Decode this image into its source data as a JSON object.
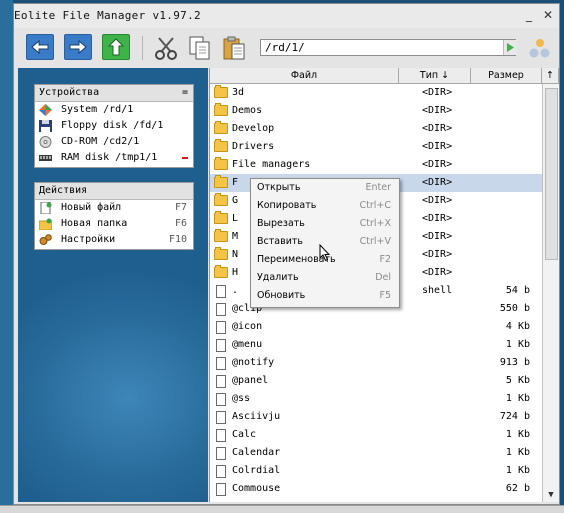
{
  "window": {
    "title": "Eolite File Manager v1.97.2",
    "minimize_glyph": "_",
    "close_glyph": "✕"
  },
  "toolbar": {
    "back_icon": "arrow-left-icon",
    "forward_icon": "arrow-right-icon",
    "up_icon": "arrow-up-icon",
    "path": "/rd/1/"
  },
  "drives_panel": {
    "title": "Устройства",
    "collapse_glyph": "=",
    "items": [
      {
        "label": "System /rd/1",
        "icon": "system-drive-icon"
      },
      {
        "label": "Floppy disk /fd/1",
        "icon": "floppy-icon"
      },
      {
        "label": "CD-ROM /cd2/1",
        "icon": "cdrom-icon"
      },
      {
        "label": "RAM disk /tmp1/1",
        "icon": "ram-disk-icon"
      }
    ]
  },
  "actions_panel": {
    "title": "Действия",
    "items": [
      {
        "label": "Новый файл",
        "key": "F7"
      },
      {
        "label": "Новая папка",
        "key": "F6"
      },
      {
        "label": "Настройки",
        "key": "F10"
      }
    ]
  },
  "filelist": {
    "columns": {
      "name": "Файл",
      "type": "Тип ↓",
      "size": "Размер",
      "sort_arrow": "↑"
    },
    "rows": [
      {
        "name": "3d",
        "type": "<DIR>",
        "size": "",
        "kind": "folder"
      },
      {
        "name": "Demos",
        "type": "<DIR>",
        "size": "",
        "kind": "folder"
      },
      {
        "name": "Develop",
        "type": "<DIR>",
        "size": "",
        "kind": "folder"
      },
      {
        "name": "Drivers",
        "type": "<DIR>",
        "size": "",
        "kind": "folder"
      },
      {
        "name": "File managers",
        "type": "<DIR>",
        "size": "",
        "kind": "folder"
      },
      {
        "name": "F",
        "type": "<DIR>",
        "size": "",
        "kind": "folder"
      },
      {
        "name": "G",
        "type": "<DIR>",
        "size": "",
        "kind": "folder"
      },
      {
        "name": "L",
        "type": "<DIR>",
        "size": "",
        "kind": "folder"
      },
      {
        "name": "M",
        "type": "<DIR>",
        "size": "",
        "kind": "folder"
      },
      {
        "name": "N",
        "type": "<DIR>",
        "size": "",
        "kind": "folder"
      },
      {
        "name": "H",
        "type": "<DIR>",
        "size": "",
        "kind": "folder"
      },
      {
        "name": ".",
        "type": "shell",
        "size": "54 b",
        "kind": "file"
      },
      {
        "name": "@clip",
        "type": "",
        "size": "550 b",
        "kind": "file"
      },
      {
        "name": "@icon",
        "type": "",
        "size": "4 Kb",
        "kind": "file"
      },
      {
        "name": "@menu",
        "type": "",
        "size": "1 Kb",
        "kind": "file"
      },
      {
        "name": "@notify",
        "type": "",
        "size": "913 b",
        "kind": "file"
      },
      {
        "name": "@panel",
        "type": "",
        "size": "5 Kb",
        "kind": "file"
      },
      {
        "name": "@ss",
        "type": "",
        "size": "1 Kb",
        "kind": "file"
      },
      {
        "name": "Asciivju",
        "type": "",
        "size": "724 b",
        "kind": "file"
      },
      {
        "name": "Calc",
        "type": "",
        "size": "1 Kb",
        "kind": "file"
      },
      {
        "name": "Calendar",
        "type": "",
        "size": "1 Kb",
        "kind": "file"
      },
      {
        "name": "Colrdial",
        "type": "",
        "size": "1 Kb",
        "kind": "file"
      },
      {
        "name": "Commouse",
        "type": "",
        "size": "62 b",
        "kind": "file"
      }
    ]
  },
  "context_menu": {
    "items": [
      {
        "label": "Открыть",
        "key": "Enter"
      },
      {
        "label": "Копировать",
        "key": "Ctrl+C"
      },
      {
        "label": "Вырезать",
        "key": "Ctrl+X"
      },
      {
        "label": "Вставить",
        "key": "Ctrl+V"
      },
      {
        "label": "Переименовать",
        "key": "F2"
      },
      {
        "label": "Удалить",
        "key": "Del"
      },
      {
        "label": "Обновить",
        "key": "F5"
      }
    ]
  },
  "colors": {
    "accent": "#3a7bc8",
    "up_button": "#3eb34a",
    "selection": "#c8d7e9",
    "folder": "#f3c445",
    "desktop": "#1f5f90"
  }
}
